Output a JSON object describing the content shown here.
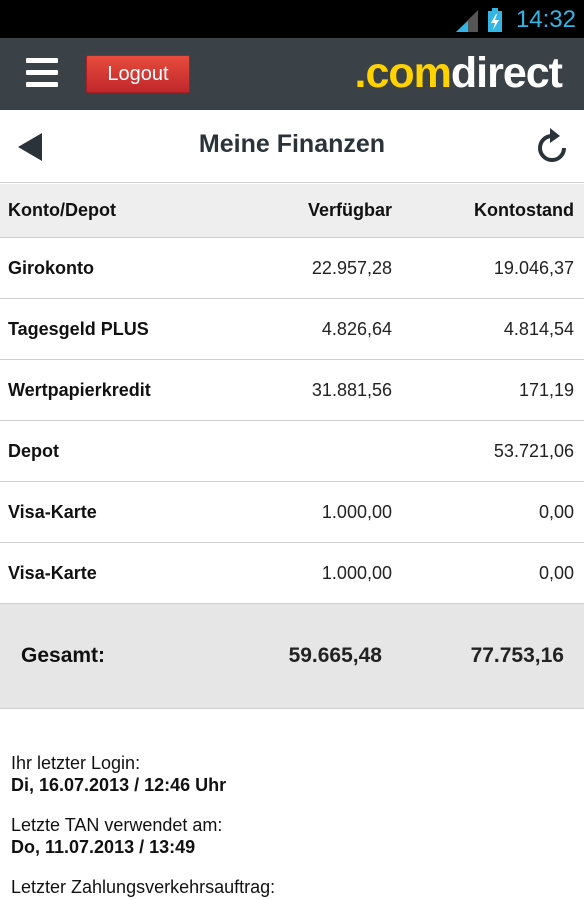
{
  "status_bar": {
    "time": "14:32",
    "icons": [
      "signal-icon",
      "battery-charging-icon"
    ],
    "time_color": "#33b5e5"
  },
  "app_bar": {
    "menu_icon": "hamburger-menu-icon",
    "logout_label": "Logout",
    "logo_prefix": ".com",
    "logo_suffix": "direct",
    "background": "#3a4247",
    "logout_color": "#d9363a",
    "logo_accent": "#ffd200"
  },
  "title_bar": {
    "back_icon": "back-arrow-icon",
    "title": "Meine Finanzen",
    "refresh_icon": "refresh-icon"
  },
  "table": {
    "headers": [
      "Konto/Depot",
      "Verfügbar",
      "Kontostand"
    ],
    "rows": [
      {
        "account": "Girokonto",
        "available": "22.957,28",
        "balance": "19.046,37"
      },
      {
        "account": "Tagesgeld PLUS",
        "available": "4.826,64",
        "balance": "4.814,54"
      },
      {
        "account": "Wertpapierkredit",
        "available": "31.881,56",
        "balance": "171,19"
      },
      {
        "account": "Depot",
        "available": "",
        "balance": "53.721,06"
      },
      {
        "account": "Visa-Karte",
        "available": "1.000,00",
        "balance": "0,00"
      },
      {
        "account": "Visa-Karte",
        "available": "1.000,00",
        "balance": "0,00"
      }
    ],
    "total": {
      "label": "Gesamt:",
      "available": "59.665,48",
      "balance": "77.753,16"
    }
  },
  "info": {
    "last_login_label": "Ihr letzter Login:",
    "last_login_value": "Di, 16.07.2013 / 12:46 Uhr",
    "last_tan_label": "Letzte TAN verwendet am:",
    "last_tan_value": "Do, 11.07.2013 / 13:49",
    "last_payment_label": "Letzter Zahlungsverkehrsauftrag:"
  }
}
